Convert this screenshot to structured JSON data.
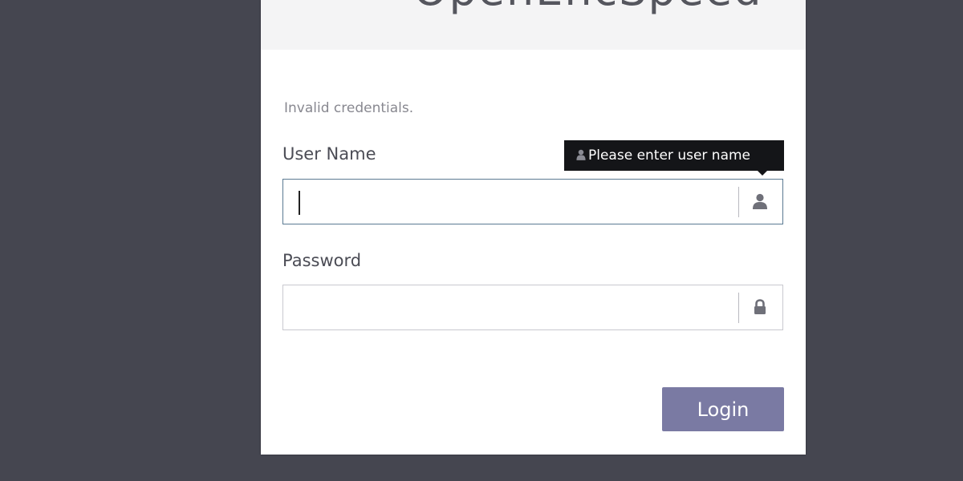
{
  "header": {
    "logo_text": "OpenEncSpeed"
  },
  "form": {
    "error_message": "Invalid credentials.",
    "username": {
      "label": "User Name",
      "value": "",
      "icon": "user-icon"
    },
    "password": {
      "label": "Password",
      "value": "",
      "icon": "lock-icon"
    },
    "tooltip": {
      "text": "Please enter user name",
      "icon": "user-icon"
    },
    "login_label": "Login"
  },
  "colors": {
    "background": "#454650",
    "card": "#ffffff",
    "header": "#f4f4f5",
    "accent_button": "#7a7aa3",
    "focus_border": "#5b7a92",
    "tooltip_bg": "#141518",
    "logo_bolt": "#f2c21b"
  }
}
